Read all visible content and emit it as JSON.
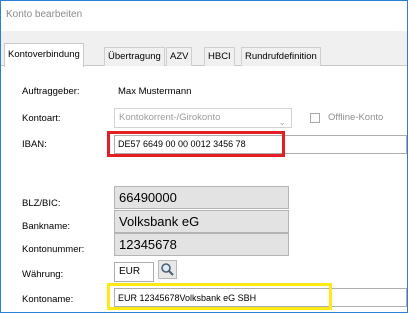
{
  "window": {
    "title": "Konto bearbeiten"
  },
  "tabs": [
    {
      "label": "Kontoverbindung",
      "active": true
    },
    {
      "label": "Übertragung",
      "active": false
    },
    {
      "label": "AZV",
      "active": false
    },
    {
      "label": "HBCI",
      "active": false
    },
    {
      "label": "Rundrufdefinition",
      "active": false
    }
  ],
  "form": {
    "auftraggeber": {
      "label": "Auftraggeber:",
      "value": "Max Mustermann"
    },
    "kontoart": {
      "label": "Kontoart:",
      "value": "Kontokorrent-/Girokonto"
    },
    "offline": {
      "label": "Offline-Konto",
      "checked": false
    },
    "iban": {
      "label": "IBAN:",
      "value": "DE57 6649 00 00 0012 3456 78"
    },
    "blz": {
      "label": "BLZ/BIC:",
      "value": "66490000"
    },
    "bankname": {
      "label": "Bankname:",
      "value": "Volksbank eG"
    },
    "kontonummer": {
      "label": "Kontonummer:",
      "value": "12345678"
    },
    "waehrung": {
      "label": "Währung:",
      "value": "EUR",
      "lookup_icon": "search-icon"
    },
    "kontoname": {
      "label": "Kontoname:",
      "value": "EUR 12345678Volksbank eG SBH"
    }
  },
  "highlights": {
    "red": "#e41e26",
    "yellow": "#ffe917"
  }
}
